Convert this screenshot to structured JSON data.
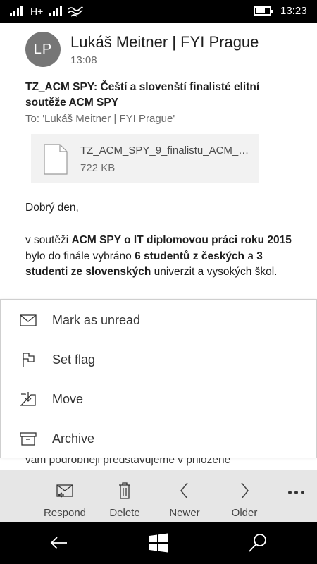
{
  "status": {
    "network": "H+",
    "time": "13:23",
    "battery_level": 0.6
  },
  "header": {
    "avatar_initials": "LP",
    "sender": "Lukáš Meitner | FYI Prague",
    "time": "13:08",
    "subject": "TZ_ACM SPY: Čeští a slovenští finalisté elitní soutěže ACM SPY",
    "to_label": "To:",
    "to": "'Lukáš Meitner | FYI Prague'"
  },
  "attachment": {
    "name": "TZ_ACM_SPY_9_finalistu_ACM_S...",
    "size": "722 KB"
  },
  "body": {
    "greeting": "Dobrý den,",
    "para": [
      {
        "text": "v soutěži ",
        "bold": false
      },
      {
        "text": "ACM SPY o IT diplomovou práci roku 2015",
        "bold": true
      },
      {
        "text": " bylo do finále vybráno ",
        "bold": false
      },
      {
        "text": "6 studentů z českých",
        "bold": true
      },
      {
        "text": " a ",
        "bold": false
      },
      {
        "text": "3 studenti ze slovenských",
        "bold": true
      },
      {
        "text": " univerzit a vysokých škol.",
        "bold": false
      }
    ],
    "partial_line": "vám podrobněji představujeme v přiložené"
  },
  "menu": {
    "items": [
      {
        "label": "Mark as unread",
        "icon": "envelope-icon"
      },
      {
        "label": "Set flag",
        "icon": "flag-icon"
      },
      {
        "label": "Move",
        "icon": "move-to-folder-icon"
      },
      {
        "label": "Archive",
        "icon": "archive-icon"
      }
    ]
  },
  "commandbar": {
    "respond": "Respond",
    "delete": "Delete",
    "newer": "Newer",
    "older": "Older",
    "more_icon": "more-icon"
  },
  "navbar": {
    "back_icon": "back-arrow-icon",
    "start_icon": "windows-logo-icon",
    "search_icon": "search-icon"
  }
}
